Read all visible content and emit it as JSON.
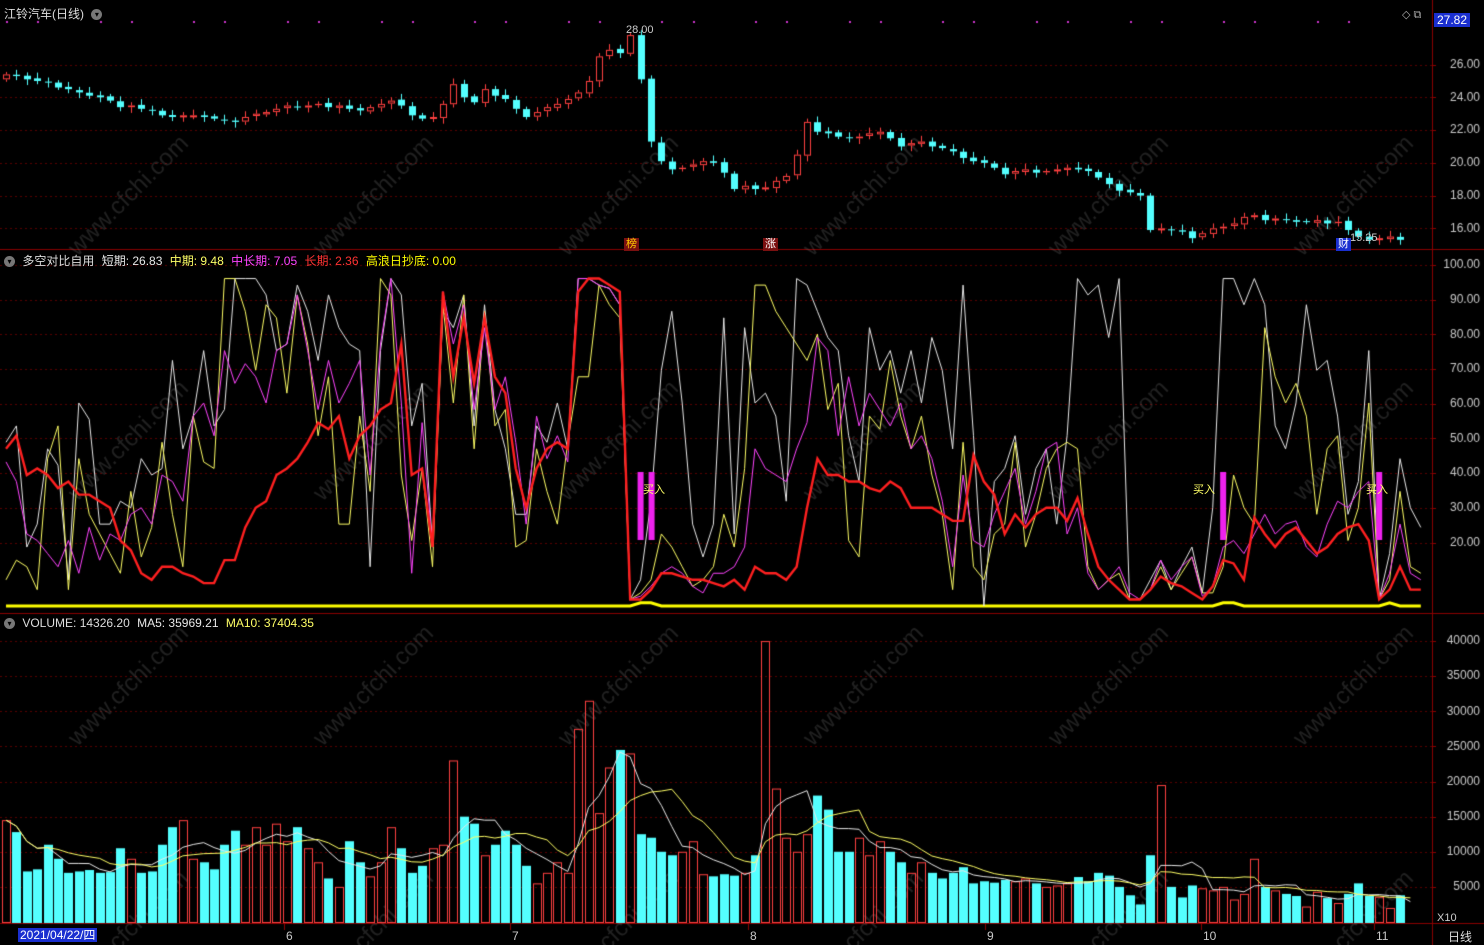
{
  "top_panel": {
    "title": "江铃汽车(日线)",
    "price_tag": "27.82",
    "high_label": "28.00",
    "low_label": "15.25",
    "badges": [
      "榜",
      "涨",
      "财"
    ]
  },
  "mid_panel": {
    "title": "多空对比自用",
    "items": [
      {
        "label": "短期: 26.83",
        "color": "#e8e8e8"
      },
      {
        "label": "中期: 9.48",
        "color": "#ffff66"
      },
      {
        "label": "中长期: 7.05",
        "color": "#ff44ff"
      },
      {
        "label": "长期: 2.36",
        "color": "#ff3333"
      },
      {
        "label": "高浪日抄底: 0.00",
        "color": "#ffff00"
      }
    ],
    "signal_label": "买入"
  },
  "vol_panel": {
    "title": "VOLUME: 14326.20",
    "ma5": "MA5: 35969.21",
    "ma10": "MA10: 37404.35",
    "unit": "X10"
  },
  "footer": {
    "date_cursor": "2021/04/22/四",
    "period": "日线",
    "x_labels": [
      "6",
      "7",
      "8",
      "9",
      "10",
      "11"
    ]
  },
  "watermark": "www.cfchi.com",
  "chart_data": [
    {
      "type": "candlestick",
      "title": "江铃汽车(日线)",
      "y_ticks": [
        16,
        18,
        20,
        22,
        24,
        26
      ],
      "ylim": [
        14.8,
        28.6
      ],
      "close": [
        25.4,
        25.3,
        25.1,
        25.0,
        24.9,
        24.6,
        24.5,
        24.3,
        24.1,
        24.0,
        23.8,
        23.4,
        23.5,
        23.3,
        23.2,
        22.9,
        22.8,
        22.9,
        22.9,
        22.8,
        22.7,
        22.6,
        22.5,
        22.8,
        23.0,
        23.1,
        23.3,
        23.5,
        23.4,
        23.5,
        23.6,
        23.4,
        23.5,
        23.3,
        23.2,
        23.4,
        23.6,
        23.8,
        23.5,
        22.9,
        22.7,
        22.8,
        23.6,
        24.8,
        24.0,
        23.7,
        24.5,
        24.1,
        23.9,
        23.3,
        22.8,
        23.1,
        23.4,
        23.6,
        23.9,
        24.3,
        25.0,
        26.5,
        26.9,
        26.7,
        27.8,
        25.1,
        21.3,
        20.1,
        19.6,
        19.7,
        19.9,
        20.1,
        20.0,
        19.4,
        18.4,
        18.6,
        18.4,
        18.5,
        18.9,
        19.2,
        20.5,
        22.5,
        21.9,
        21.8,
        21.6,
        21.5,
        21.6,
        21.8,
        21.9,
        21.5,
        21.0,
        21.2,
        21.3,
        21.0,
        20.9,
        20.7,
        20.3,
        20.1,
        20.0,
        19.7,
        19.3,
        19.5,
        19.6,
        19.4,
        19.5,
        19.6,
        19.7,
        19.6,
        19.5,
        19.1,
        18.7,
        18.3,
        18.2,
        18.0,
        15.9,
        16.0,
        15.9,
        15.8,
        15.4,
        15.7,
        16.0,
        16.1,
        16.3,
        16.7,
        16.8,
        16.5,
        16.6,
        16.5,
        16.4,
        16.4,
        16.5,
        16.3,
        16.4,
        15.9,
        15.5,
        15.3,
        15.4,
        15.5,
        15.3
      ]
    },
    {
      "type": "line",
      "title": "多空对比自用",
      "y_ticks": [
        20,
        30,
        40,
        50,
        60,
        70,
        80,
        90,
        100
      ],
      "ylim": [
        0,
        102
      ],
      "series": [
        {
          "name": "短期",
          "values": [
            50,
            55,
            18,
            25,
            48,
            43,
            8,
            62,
            57,
            25,
            25,
            32,
            30,
            45,
            40,
            42,
            75,
            48,
            58,
            78,
            55,
            60,
            100,
            100,
            100,
            95,
            78,
            80,
            98,
            90,
            75,
            95,
            85,
            80,
            78,
            12,
            78,
            100,
            95,
            55,
            68,
            18,
            90,
            85,
            95,
            55,
            92,
            60,
            48,
            28,
            28,
            55,
            50,
            62,
            48,
            100,
            100,
            98,
            97,
            92,
            2,
            8,
            32,
            72,
            90,
            62,
            25,
            15,
            25,
            88,
            22,
            85,
            62,
            65,
            58,
            32,
            100,
            98,
            90,
            82,
            78,
            52,
            38,
            85,
            72,
            78,
            65,
            78,
            62,
            82,
            72,
            48,
            98,
            52,
            0,
            38,
            42,
            52,
            28,
            42,
            48,
            25,
            52,
            100,
            95,
            98,
            82,
            100,
            2,
            2,
            8,
            14,
            5,
            12,
            18,
            4,
            30,
            100,
            100,
            92,
            100,
            92,
            55,
            48,
            62,
            92,
            72,
            75,
            58,
            28,
            38,
            78,
            2,
            16,
            45,
            30,
            24
          ]
        },
        {
          "name": "中期",
          "values": [
            8,
            14,
            12,
            5,
            45,
            55,
            5,
            45,
            28,
            22,
            16,
            10,
            35,
            15,
            24,
            50,
            28,
            12,
            58,
            44,
            42,
            100,
            100,
            90,
            72,
            92,
            88,
            65,
            95,
            80,
            52,
            70,
            25,
            25,
            58,
            35,
            100,
            95,
            40,
            20,
            42,
            12,
            92,
            62,
            95,
            48,
            90,
            55,
            60,
            18,
            20,
            48,
            35,
            25,
            50,
            70,
            70,
            98,
            92,
            88,
            2,
            4,
            8,
            22,
            18,
            12,
            6,
            8,
            12,
            28,
            18,
            42,
            98,
            98,
            90,
            85,
            80,
            75,
            83,
            60,
            68,
            20,
            15,
            58,
            54,
            75,
            58,
            48,
            58,
            40,
            28,
            5,
            50,
            12,
            8,
            22,
            25,
            50,
            18,
            28,
            42,
            48,
            50,
            48,
            12,
            5,
            8,
            10,
            2,
            2,
            5,
            12,
            5,
            10,
            15,
            4,
            4,
            12,
            40,
            30,
            25,
            85,
            70,
            62,
            68,
            58,
            28,
            48,
            52,
            20,
            30,
            62,
            2,
            8,
            35,
            12,
            10
          ]
        },
        {
          "name": "中长期",
          "values": [
            44,
            38,
            22,
            20,
            16,
            12,
            20,
            10,
            24,
            14,
            22,
            20,
            28,
            30,
            25,
            40,
            38,
            32,
            58,
            62,
            52,
            78,
            68,
            74,
            70,
            62,
            78,
            80,
            95,
            78,
            60,
            75,
            62,
            68,
            75,
            40,
            80,
            100,
            62,
            10,
            56,
            18,
            96,
            80,
            92,
            60,
            85,
            60,
            70,
            50,
            25,
            58,
            45,
            52,
            44,
            100,
            100,
            98,
            97,
            92,
            2,
            3,
            6,
            10,
            12,
            10,
            6,
            4,
            10,
            10,
            12,
            18,
            48,
            42,
            40,
            38,
            48,
            56,
            82,
            78,
            52,
            70,
            55,
            65,
            60,
            55,
            62,
            48,
            52,
            45,
            32,
            12,
            40,
            20,
            18,
            28,
            35,
            42,
            25,
            35,
            48,
            50,
            22,
            30,
            10,
            5,
            8,
            12,
            4,
            2,
            5,
            14,
            8,
            12,
            15,
            3,
            6,
            18,
            20,
            16,
            22,
            28,
            22,
            25,
            26,
            18,
            15,
            25,
            32,
            30,
            35,
            38,
            2,
            10,
            25,
            10,
            8
          ]
        },
        {
          "name": "长期",
          "values": [
            48,
            52,
            40,
            42,
            40,
            36,
            38,
            34,
            34,
            32,
            30,
            20,
            17,
            10,
            8,
            12,
            12,
            10,
            9,
            7,
            7,
            14,
            14,
            24,
            30,
            32,
            40,
            42,
            45,
            50,
            56,
            54,
            58,
            45,
            52,
            55,
            60,
            62,
            80,
            40,
            42,
            18,
            96,
            70,
            88,
            68,
            88,
            70,
            65,
            42,
            30,
            42,
            48,
            50,
            48,
            96,
            100,
            100,
            98,
            96,
            2,
            2,
            5,
            10,
            10,
            9,
            8,
            8,
            7,
            6,
            8,
            5,
            12,
            10,
            10,
            8,
            12,
            30,
            45,
            40,
            40,
            38,
            38,
            36,
            35,
            38,
            36,
            30,
            30,
            30,
            28,
            26,
            26,
            46,
            38,
            34,
            22,
            28,
            24,
            28,
            30,
            30,
            26,
            33,
            22,
            12,
            8,
            5,
            2,
            2,
            5,
            9,
            7,
            6,
            4,
            2,
            6,
            14,
            13,
            8,
            27,
            22,
            18,
            22,
            24,
            20,
            16,
            18,
            22,
            24,
            25,
            20,
            2,
            5,
            12,
            5,
            5
          ]
        },
        {
          "name": "高浪日抄底",
          "values": [
            0,
            0,
            0,
            0,
            0,
            0,
            0,
            0,
            0,
            0,
            0,
            0,
            0,
            0,
            0,
            0,
            0,
            0,
            0,
            0,
            0,
            0,
            0,
            0,
            0,
            0,
            0,
            0,
            0,
            0,
            0,
            0,
            0,
            0,
            0,
            0,
            0,
            0,
            0,
            0,
            0,
            0,
            0,
            0,
            0,
            0,
            0,
            0,
            0,
            0,
            0,
            0,
            0,
            0,
            0,
            0,
            0,
            0,
            0,
            0,
            0,
            1,
            1,
            0,
            0,
            0,
            0,
            0,
            0,
            0,
            0,
            0,
            0,
            0,
            0,
            0,
            0,
            0,
            0,
            0,
            0,
            0,
            0,
            0,
            0,
            0,
            0,
            0,
            0,
            0,
            0,
            0,
            0,
            0,
            0,
            0,
            0,
            0,
            0,
            0,
            0,
            0,
            0,
            0,
            0,
            0,
            0,
            0,
            0,
            0,
            0,
            0,
            0,
            0,
            0,
            0,
            0,
            1,
            1,
            0,
            0,
            0,
            0,
            0,
            0,
            0,
            0,
            0,
            0,
            0,
            0,
            0,
            0,
            1,
            0,
            0,
            0
          ]
        }
      ],
      "signals": [
        {
          "bar": 61,
          "label": "买入"
        },
        {
          "bar": 117,
          "label": "买入"
        },
        {
          "bar": 132,
          "label": "买入"
        }
      ]
    },
    {
      "type": "bar",
      "title": "VOLUME",
      "y_ticks": [
        5000,
        10000,
        15000,
        20000,
        25000,
        30000,
        35000,
        40000
      ],
      "ylim": [
        0,
        43000
      ],
      "values": [
        14500,
        12800,
        7200,
        7500,
        11000,
        9000,
        7000,
        7200,
        7400,
        7000,
        7100,
        10500,
        9000,
        7000,
        7200,
        11000,
        13500,
        14500,
        9000,
        8500,
        7500,
        11000,
        13000,
        11000,
        13500,
        11000,
        14000,
        11500,
        13500,
        10500,
        8500,
        6200,
        5000,
        11500,
        8500,
        6500,
        8500,
        13500,
        10500,
        7000,
        8000,
        10500,
        11000,
        23000,
        15000,
        14000,
        9500,
        11000,
        13000,
        11000,
        8000,
        5500,
        7000,
        8500,
        7000,
        27500,
        31500,
        15500,
        22000,
        24500,
        24000,
        12500,
        12000,
        10000,
        9500,
        10000,
        11500,
        6800,
        6500,
        6800,
        6600,
        7000,
        9500,
        40000,
        19000,
        12000,
        10000,
        12500,
        18000,
        16000,
        10000,
        10000,
        12000,
        9500,
        11500,
        10000,
        8500,
        7000,
        8500,
        7000,
        6200,
        7000,
        7800,
        5500,
        5800,
        5600,
        6000,
        5800,
        6200,
        5500,
        5000,
        5200,
        5500,
        6400,
        5800,
        7000,
        6600,
        5000,
        3800,
        2500,
        9500,
        19500,
        5000,
        3500,
        5200,
        4800,
        4500,
        5000,
        3200,
        4000,
        9000,
        5000,
        4500,
        4000,
        3700,
        2200,
        4300,
        3400,
        2700,
        4000,
        5500,
        3700,
        3600,
        2000,
        3800,
        1400
      ],
      "ma_series": [
        {
          "name": "MA5"
        },
        {
          "name": "MA10"
        }
      ]
    }
  ]
}
